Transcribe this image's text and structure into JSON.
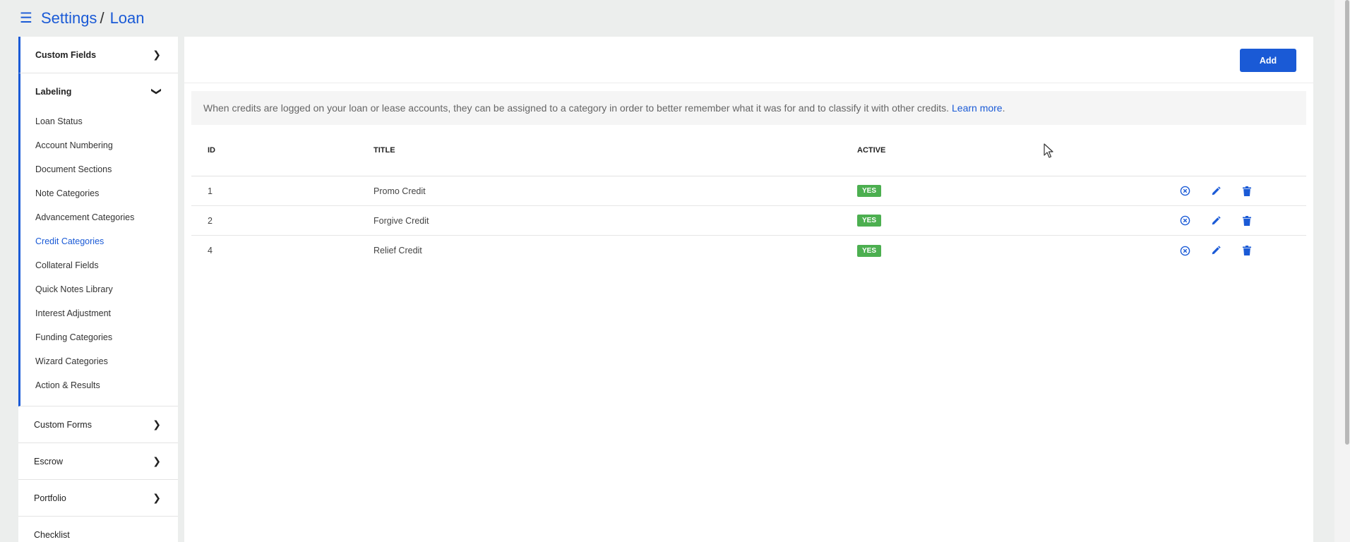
{
  "header": {
    "menu_icon": "hamburger-icon",
    "crumbs": [
      "Settings",
      "Loan"
    ],
    "separator": "/"
  },
  "sidebar": {
    "groups": [
      {
        "label": "Custom Fields",
        "expanded": false
      },
      {
        "label": "Labeling",
        "expanded": true
      },
      {
        "label": "Custom Forms",
        "expanded": false
      },
      {
        "label": "Escrow",
        "expanded": false
      },
      {
        "label": "Portfolio",
        "expanded": false
      },
      {
        "label": "Checklist",
        "expanded": false
      }
    ],
    "labeling_items": [
      "Loan Status",
      "Account Numbering",
      "Document Sections",
      "Note Categories",
      "Advancement Categories",
      "Credit Categories",
      "Collateral Fields",
      "Quick Notes Library",
      "Interest Adjustment",
      "Funding Categories",
      "Wizard Categories",
      "Action & Results"
    ],
    "selected": "Credit Categories"
  },
  "main": {
    "add_label": "Add",
    "info_text": "When credits are logged on your loan or lease accounts, they can be assigned to a category in order to better remember what it was for and to classify it with other credits.",
    "learn_more": "Learn more",
    "learn_more_suffix": ".",
    "columns": [
      "ID",
      "TITLE",
      "ACTIVE"
    ],
    "rows": [
      {
        "id": "1",
        "title": "Promo Credit",
        "active": "YES"
      },
      {
        "id": "2",
        "title": "Forgive Credit",
        "active": "YES"
      },
      {
        "id": "4",
        "title": "Relief Credit",
        "active": "YES"
      }
    ],
    "row_actions": [
      "deactivate-icon",
      "edit-icon",
      "delete-icon"
    ]
  },
  "colors": {
    "accent": "#1a5ad6",
    "badge_green": "#4caf50"
  }
}
